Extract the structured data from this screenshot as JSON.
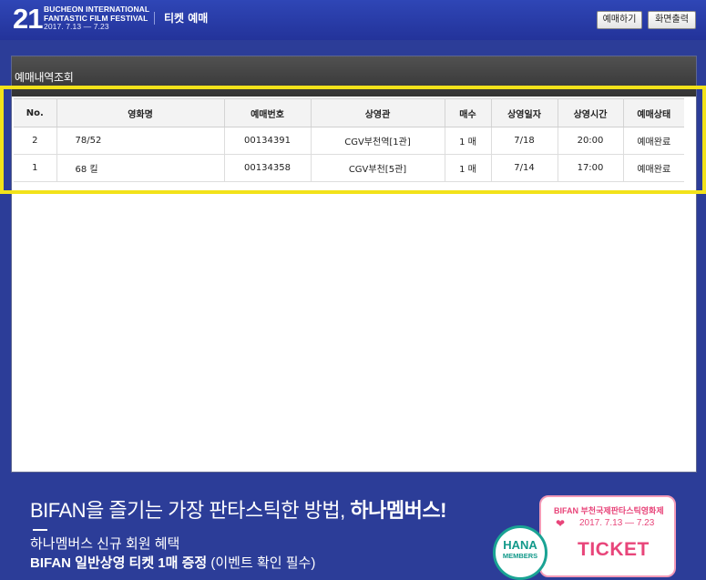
{
  "header": {
    "logo_number": "21",
    "logo_line1": "BUCHEON INTERNATIONAL",
    "logo_line2": "FANTASTIC FILM FESTIVAL",
    "logo_dates": "2017. 7.13 — 7.23",
    "title": "티켓 예매",
    "reserve_button": "예매하기",
    "print_button": "화면출력"
  },
  "panel": {
    "title": "예매내역조회"
  },
  "table": {
    "columns": [
      "No.",
      "영화명",
      "예매번호",
      "상영관",
      "매수",
      "상영일자",
      "상영시간",
      "예매상태"
    ],
    "rows": [
      {
        "no": "2",
        "title": "78/52",
        "booking_no": "00134391",
        "theater": "CGV부천역[1관]",
        "count": "1 매",
        "date": "7/18",
        "time": "20:00",
        "status": "예매완료"
      },
      {
        "no": "1",
        "title": "68 킬",
        "booking_no": "00134358",
        "theater": "CGV부천[5관]",
        "count": "1 매",
        "date": "7/14",
        "time": "17:00",
        "status": "예매완료"
      }
    ]
  },
  "banner": {
    "tagline_prefix": "BIFAN을 즐기는 가장 판타스틱한 방법, ",
    "tagline_bold": "하나멤버스!",
    "line1": "하나멤버스 신규 회원 혜택",
    "line2_bold": "BIFAN 일반상영 티켓 1매 증정",
    "line2_note": " (이벤트 확인 필수)",
    "hana_text": "HANA",
    "hana_sub": "MEMBERS",
    "ticket_brand": "BIFAN",
    "ticket_festival": "부천국제판타스틱영화제",
    "ticket_dates": "2017. 7.13 — 7.23",
    "ticket_word": "TICKET"
  },
  "colors": {
    "background": "#2c3d98",
    "highlight": "#f2e21a",
    "ticket_pink": "#e8457a",
    "hana_green": "#1aa394"
  }
}
